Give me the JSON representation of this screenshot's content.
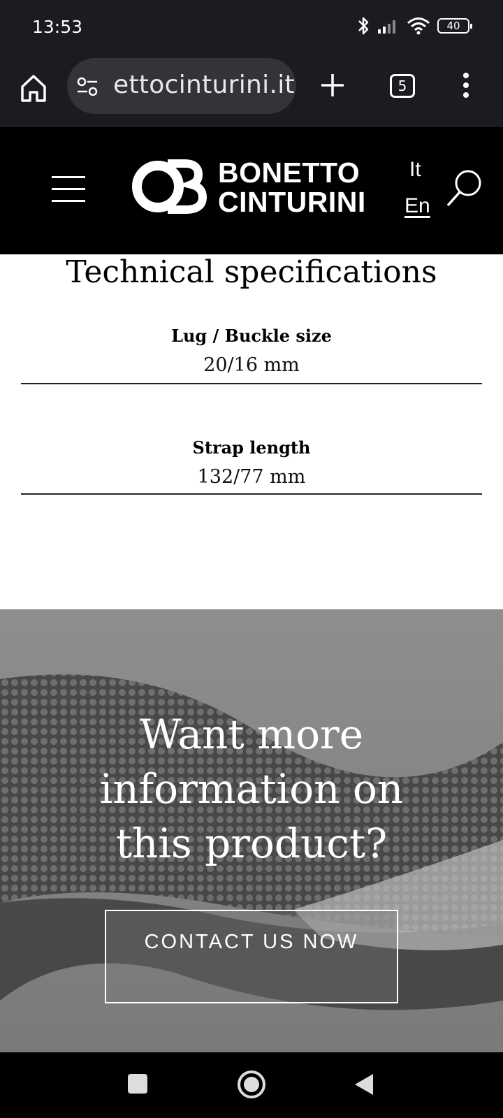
{
  "status_bar": {
    "time": "13:53",
    "battery": "40"
  },
  "browser": {
    "url": "ettocinturini.it",
    "tab_count": "5"
  },
  "header": {
    "logo_line1": "BONETTO",
    "logo_line2": "CINTURINI",
    "lang_it": "It",
    "lang_en": "En"
  },
  "specs": {
    "title": "Technical specifications",
    "items": [
      {
        "label": "Lug / Buckle size",
        "value": "20/16 mm"
      },
      {
        "label": "Strap length",
        "value": "132/77 mm"
      }
    ]
  },
  "banner": {
    "title": "Want more information on this product?",
    "button_label": "CONTACT US NOW"
  },
  "icons": {
    "home": "home-icon",
    "site_settings": "site-settings-icon",
    "new_tab": "plus-icon",
    "tabs": "tabs-icon",
    "more": "more-vert-icon",
    "menu": "hamburger-icon",
    "search": "search-icon",
    "recents": "recents-icon",
    "nav_home": "home-circle-icon",
    "back": "back-icon"
  }
}
